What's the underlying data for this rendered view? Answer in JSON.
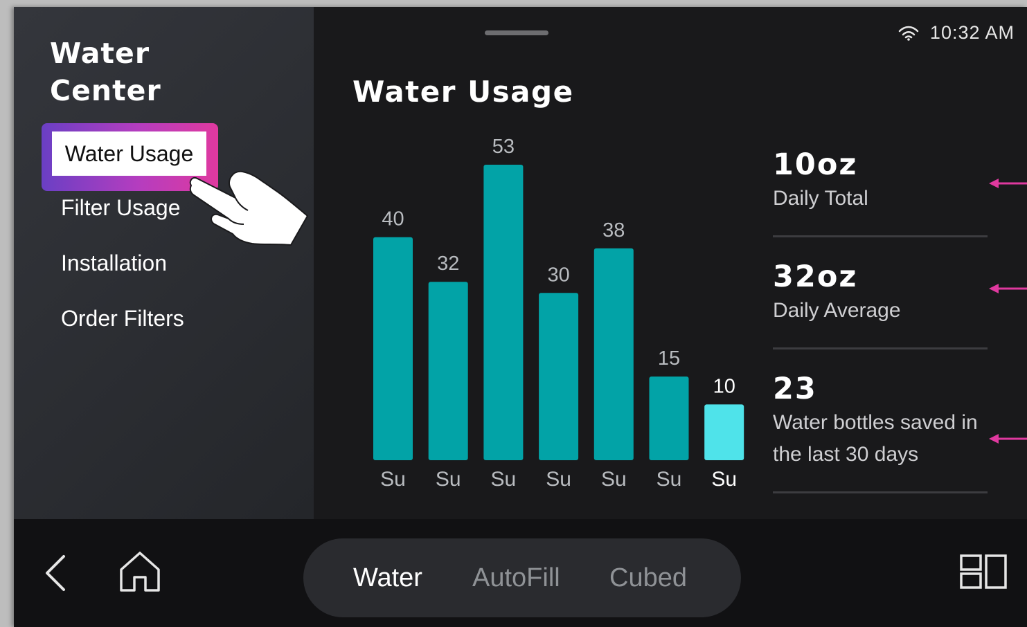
{
  "status_bar": {
    "time": "10:32 AM",
    "wifi_icon": "wifi-icon"
  },
  "sidebar": {
    "title": "Water Center",
    "items": [
      {
        "label": "Water Usage",
        "selected": true
      },
      {
        "label": "Filter Usage",
        "selected": false
      },
      {
        "label": "Installation",
        "selected": false
      },
      {
        "label": "Order Filters",
        "selected": false
      }
    ]
  },
  "main": {
    "title": "Water Usage"
  },
  "chart_data": {
    "type": "bar",
    "categories": [
      "Su",
      "Su",
      "Su",
      "Su",
      "Su",
      "Su",
      "Su"
    ],
    "values": [
      40,
      32,
      53,
      30,
      38,
      15,
      10
    ],
    "highlighted_index": 6,
    "colors": {
      "bar": "#02a3a7",
      "highlight": "#4fe3ea",
      "label": "#b9bcc0",
      "category": "#b9bcc0",
      "category_highlight": "#ffffff"
    },
    "ylim": [
      0,
      53
    ]
  },
  "stats": [
    {
      "value": "10oz",
      "label": "Daily Total"
    },
    {
      "value": "32oz",
      "label": "Daily Average"
    },
    {
      "value": "23",
      "label": "Water bottles saved in the last 30 days"
    }
  ],
  "annotation_color": "#e0399f",
  "bottom_nav": {
    "back_icon": "chevron-left-icon",
    "home_icon": "home-icon",
    "apps_icon": "apps-grid-icon",
    "modes": [
      {
        "label": "Water",
        "active": true
      },
      {
        "label": "AutoFill",
        "active": false
      },
      {
        "label": "Cubed",
        "active": false
      }
    ]
  }
}
